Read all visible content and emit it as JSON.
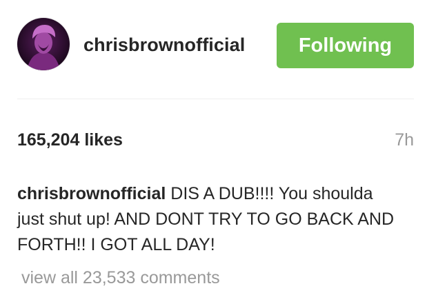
{
  "post": {
    "username": "chrisbrownofficial",
    "follow_button_label": "Following",
    "likes": "165,204 likes",
    "time": "7h",
    "caption_user": "chrisbrownofficial",
    "caption_text": "DIS A DUB!!!! You shoulda just shut up! AND DONT TRY TO GO BACK AND FORTH!! I GOT ALL DAY!",
    "view_comments": "view all 23,533 comments"
  },
  "colors": {
    "follow_button": "#70c050",
    "text": "#262626",
    "muted": "#999999"
  }
}
